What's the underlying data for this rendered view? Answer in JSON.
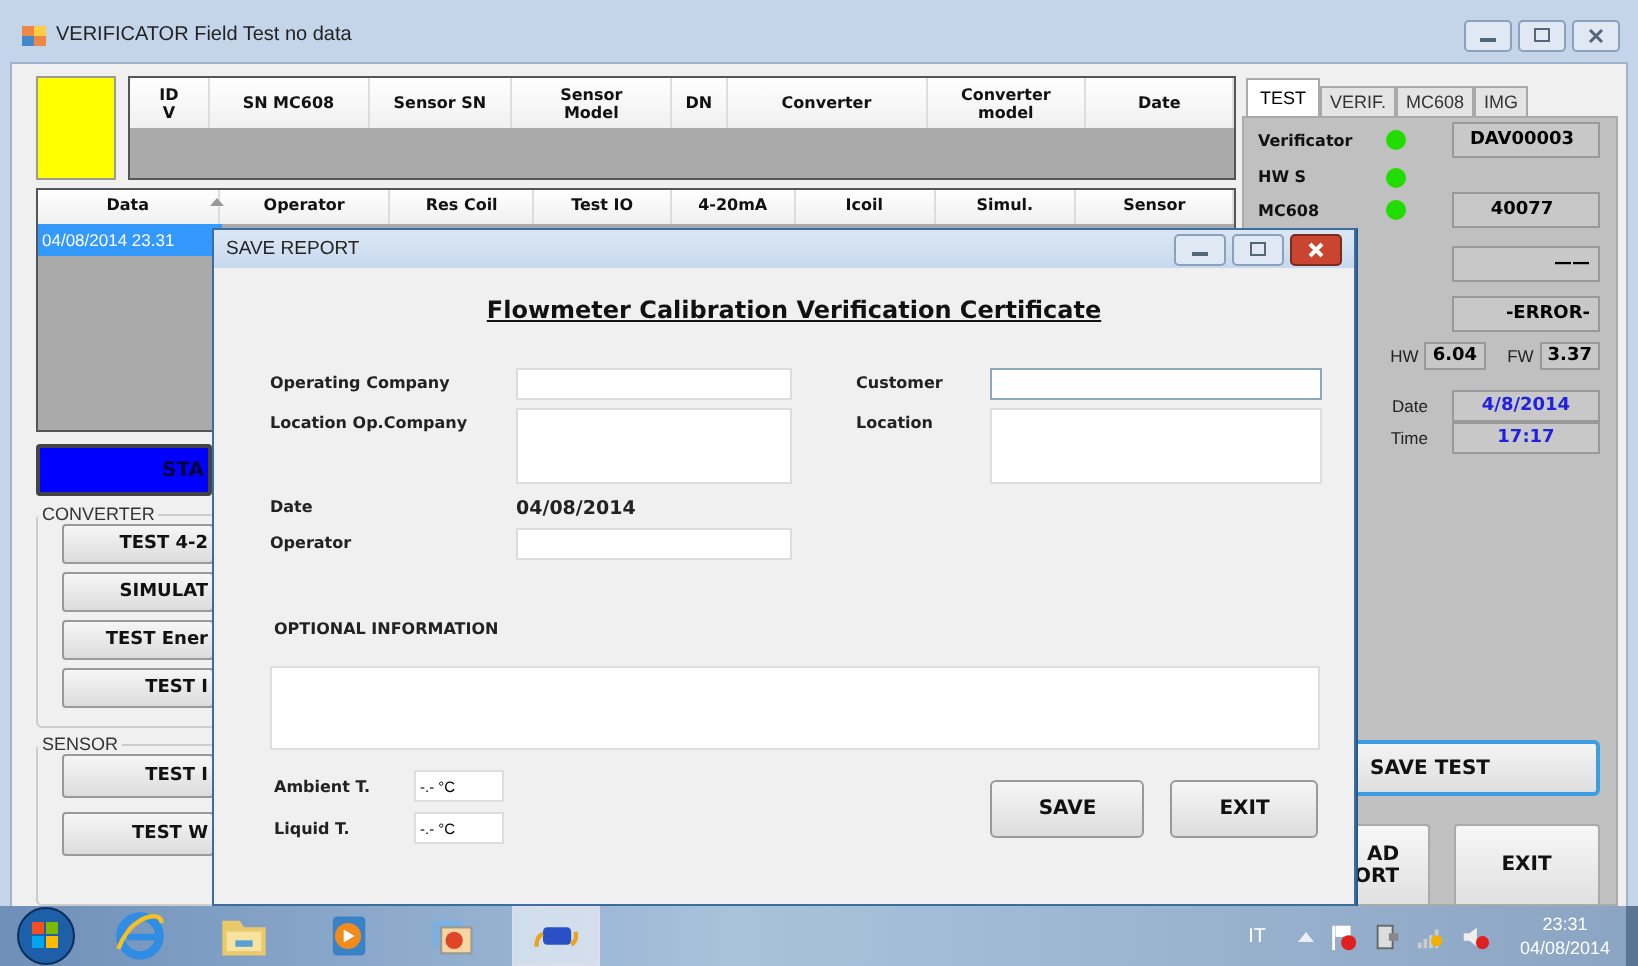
{
  "window": {
    "title": "VERIFICATOR Field Test no data"
  },
  "device_table": {
    "columns": [
      "ID\nV",
      "SN MC608",
      "Sensor SN",
      "Sensor\nModel",
      "DN",
      "Converter",
      "Converter\nmodel",
      "Date"
    ]
  },
  "tests_table": {
    "columns": [
      "Data",
      "Operator",
      "Res Coil",
      "Test IO",
      "4-20mA",
      "Icoil",
      "Simul.",
      "Sensor"
    ],
    "rows": [
      {
        "date": "04/08/2014 23.31",
        "selected": true
      }
    ]
  },
  "start_button": "STA",
  "converter_group": {
    "title": "CONVERTER",
    "buttons": [
      "TEST 4-2",
      "SIMULAT",
      "TEST Ener",
      "TEST I"
    ]
  },
  "sensor_group": {
    "title": "SENSOR",
    "buttons": [
      "TEST I",
      "TEST W"
    ]
  },
  "tabs": [
    {
      "label": "TEST",
      "selected": true
    },
    {
      "label": "VERIF.",
      "selected": false
    },
    {
      "label": "MC608",
      "selected": false
    },
    {
      "label": "IMG",
      "selected": false
    }
  ],
  "status_rows": [
    {
      "label": "Verificator",
      "led_on": true,
      "value": "DAV00003"
    },
    {
      "label": "HW S",
      "led_on": true
    },
    {
      "label": "MC608",
      "led_on": true,
      "value": "40077"
    },
    {
      "value": "——"
    },
    {
      "value": "-ERROR-"
    }
  ],
  "versions": {
    "hw_label": "HW",
    "hw": "6.04",
    "fw_label": "FW",
    "fw": "3.37"
  },
  "clock": {
    "date_label": "Date",
    "date": "4/8/2014",
    "time_label": "Time",
    "time": "17:17"
  },
  "save_test_button": "SAVE TEST",
  "bottom_buttons": [
    "AD\nORT",
    "EXIT"
  ],
  "dialog": {
    "title": "SAVE REPORT",
    "heading": "Flowmeter Calibration Verification Certificate",
    "operating_company_label": "Operating Company",
    "customer_label": "Customer",
    "location_op_label": "Location Op.Company",
    "location_label": "Location",
    "date_label": "Date",
    "date": "04/08/2014",
    "operator_label": "Operator",
    "optional_label": "OPTIONAL INFORMATION",
    "ambient_label": "Ambient T.",
    "ambient": "-.- °C",
    "liquid_label": "Liquid T.",
    "liquid": "-.- °C",
    "save_button": "SAVE",
    "exit_button": "EXIT"
  },
  "taskbar": {
    "apps": [
      {
        "kind": "browser",
        "selected": false
      },
      {
        "kind": "folder",
        "selected": false
      },
      {
        "kind": "media",
        "selected": false
      },
      {
        "kind": "pictures",
        "selected": false
      },
      {
        "kind": "app",
        "selected": true
      }
    ],
    "language": "IT",
    "time": "23:31",
    "date": "04/08/2014"
  }
}
